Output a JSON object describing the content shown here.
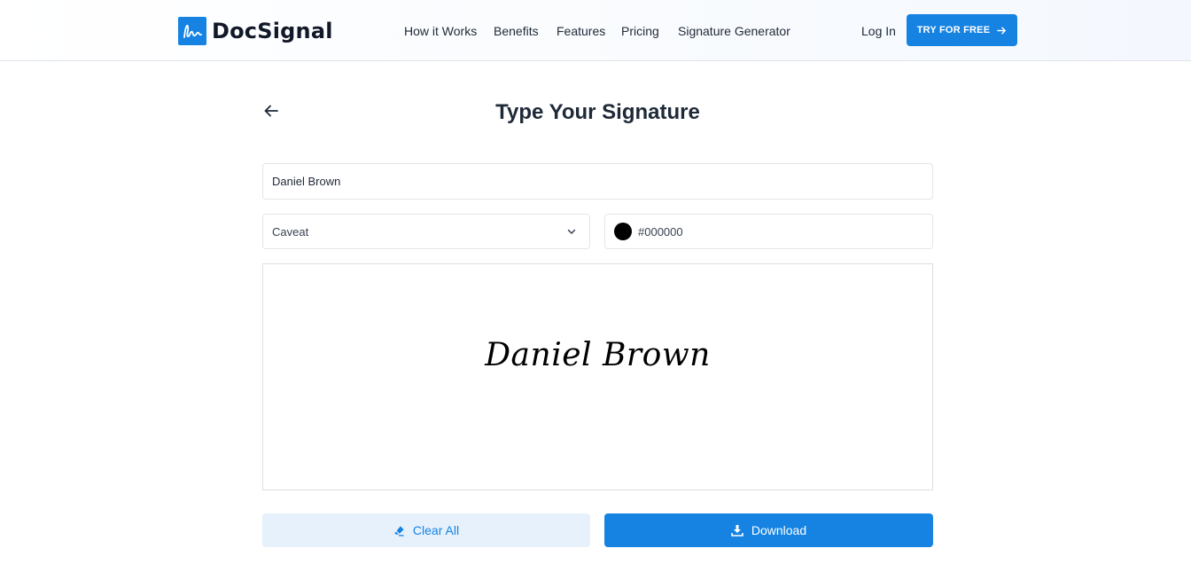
{
  "header": {
    "brand": "DocSignal",
    "nav": [
      {
        "label": "How it Works"
      },
      {
        "label": "Benefits"
      },
      {
        "label": "Features"
      },
      {
        "label": "Pricing"
      },
      {
        "label": "Signature Generator"
      }
    ],
    "login_label": "Log In",
    "cta_label": "TRY FOR FREE"
  },
  "page": {
    "title": "Type Your Signature",
    "name_value": "Daniel Brown",
    "font_selected": "Caveat",
    "color_value": "#000000",
    "preview_text": "Daniel Brown",
    "clear_label": "Clear All",
    "download_label": "Download"
  },
  "colors": {
    "accent": "#1683e3",
    "accent_light": "#e6f1fc",
    "signature": "#000000"
  },
  "icons": {
    "logo": "signature-wave-icon",
    "back": "arrow-left-icon",
    "cta": "arrow-right-icon",
    "dropdown": "chevron-down-icon",
    "clear": "eraser-icon",
    "download": "download-icon"
  }
}
